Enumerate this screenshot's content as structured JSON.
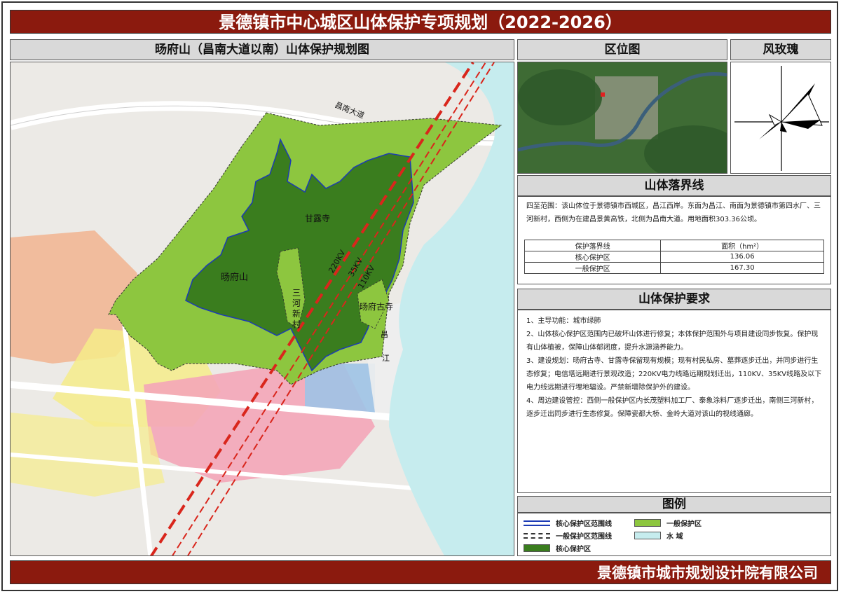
{
  "title": "景德镇市中心城区山体保护专项规划（2022-2026）",
  "footer": "景德镇市城市规划设计院有限公司",
  "map": {
    "header": "旸府山（昌南大道以南）山体保护规划图",
    "labels": {
      "road": "昌南大道",
      "ganlu": "甘露寺",
      "yangfu_shan": "旸府山",
      "sanhe": "三\n河\n新\n村",
      "yangfu_temple": "旸府古寺",
      "kv220": "220KV",
      "kv35": "35KV",
      "kv110": "110KV",
      "river_1": "昌",
      "river_2": "江"
    }
  },
  "location_map": {
    "header": "区位图"
  },
  "wind_rose": {
    "header": "风玫瑰"
  },
  "boundary": {
    "header": "山体落界线",
    "description": "四至范围：该山体位于景德镇市西城区，昌江西岸。东面为昌江、南面为景德镇市第四水厂、三河新村，西侧为在建昌景黄高铁，北侧为昌南大道。用地面积303.36公顷。",
    "table": {
      "col1": "保护落界线",
      "col2": "面积（hm²）",
      "rows": [
        {
          "name": "核心保护区",
          "area": "136.06"
        },
        {
          "name": "一般保护区",
          "area": "167.30"
        }
      ]
    }
  },
  "requirements": {
    "header": "山体保护要求",
    "items": [
      "1、主导功能：城市绿肺",
      "2、山体核心保护区范围内已破坏山体进行修复；本体保护范围外与项目建设同步恢复。保护现有山体植被，保障山体郁闭度，提升水源涵养能力。",
      "3、建设规划：旸府古寺、甘露寺保留现有规模；现有村民私房、墓葬逐步迁出，并同步进行生态修复；电信塔远期进行景观改造；220KV电力线路远期规划迁出，110KV、35KV线路及以下电力线远期进行埋地辐设。严禁新增除保护外的建设。",
      "4、周边建设管控：西侧一般保护区内长茂塑料加工厂、泰象涂料厂逐步迁出，南侧三河新村，逐步迁出同步进行生态修复。保障瓷都大桥、金岭大道对该山的视线通廊。"
    ]
  },
  "legend": {
    "header": "图例",
    "items": [
      {
        "label": "核心保护区范围线",
        "kind": "core-line"
      },
      {
        "label": "一般保护区",
        "kind": "general-fill",
        "color": "#8dc63f"
      },
      {
        "label": "一般保护区范围线",
        "kind": "general-line"
      },
      {
        "label": "水 域",
        "kind": "water-fill",
        "color": "#c6ecee"
      },
      {
        "label": "核心保护区",
        "kind": "core-fill",
        "color": "#3a7d1e"
      }
    ]
  },
  "colors": {
    "title_bg": "#8b1a0e",
    "general_zone": "#8dc63f",
    "core_zone": "#3a7d1e",
    "water": "#c6ecee",
    "power_line": "#d9261c"
  }
}
